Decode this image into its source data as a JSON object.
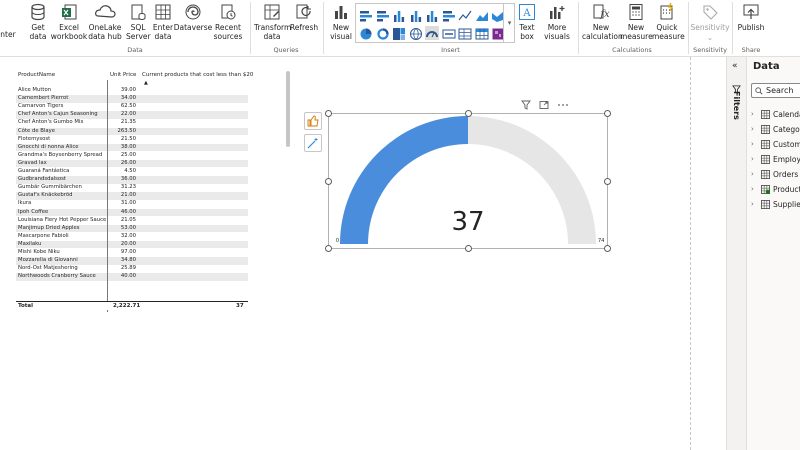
{
  "ribbon": {
    "partial_left": "nter",
    "buttons": {
      "get_data": "Get data",
      "excel": "Excel workbook",
      "onelake": "OneLake data hub",
      "sql": "SQL Server",
      "enter_data": "Enter data",
      "dataverse": "Dataverse",
      "recent": "Recent sources",
      "transform": "Transform data",
      "refresh": "Refresh",
      "new_visual": "New visual",
      "text_box": "Text box",
      "more_visuals": "More visuals",
      "new_calc": "New calculation",
      "new_measure": "New measure",
      "quick_measure": "Quick measure",
      "sensitivity": "Sensitivity",
      "publish": "Publish"
    },
    "groups": {
      "data": "Data",
      "queries": "Queries",
      "insert": "Insert",
      "calculations": "Calculations",
      "sensitivity": "Sensitivity",
      "share": "Share"
    }
  },
  "table": {
    "headers": [
      "ProductName",
      "Unit Price",
      "Current products that cost less than $20"
    ],
    "rows": [
      [
        "Alice Mutton",
        "39.00",
        ""
      ],
      [
        "Camembert Pierrot",
        "34.00",
        ""
      ],
      [
        "Carnarvon Tigers",
        "62.50",
        ""
      ],
      [
        "Chef Anton's Cajun Seasoning",
        "22.00",
        ""
      ],
      [
        "Chef Anton's Gumbo Mix",
        "21.35",
        ""
      ],
      [
        "Côte de Blaye",
        "263.50",
        ""
      ],
      [
        "Flotemysost",
        "21.50",
        ""
      ],
      [
        "Gnocchi di nonna Alice",
        "38.00",
        ""
      ],
      [
        "Grandma's Boysenberry Spread",
        "25.00",
        ""
      ],
      [
        "Gravad lax",
        "26.00",
        ""
      ],
      [
        "Guaraná Fantástica",
        "4.50",
        ""
      ],
      [
        "Gudbrandsdalsost",
        "36.00",
        ""
      ],
      [
        "Gumbär Gummibärchen",
        "31.23",
        ""
      ],
      [
        "Gustaf's Knäckebröd",
        "21.00",
        ""
      ],
      [
        "Ikura",
        "31.00",
        ""
      ],
      [
        "Ipoh Coffee",
        "46.00",
        ""
      ],
      [
        "Louisiana Fiery Hot Pepper Sauce",
        "21.05",
        ""
      ],
      [
        "Manjimup Dried Apples",
        "53.00",
        ""
      ],
      [
        "Mascarpone Fabioli",
        "32.00",
        ""
      ],
      [
        "Maxilaku",
        "20.00",
        ""
      ],
      [
        "Mishi Kobe Niku",
        "97.00",
        ""
      ],
      [
        "Mozzarella di Giovanni",
        "34.80",
        ""
      ],
      [
        "Nord-Ost Matjeshering",
        "25.89",
        ""
      ],
      [
        "Northwoods Cranberry Sauce",
        "40.00",
        ""
      ]
    ],
    "total": [
      "Total",
      "2,222.71",
      "37"
    ]
  },
  "gauge": {
    "value": 37,
    "min": 0,
    "max": 74,
    "min_label": "0",
    "max_label": "74",
    "value_label": "37",
    "fill_color": "#4a8ddc",
    "track_color": "#e6e6e6"
  },
  "panes": {
    "filters_label": "Filters",
    "data_title": "Data",
    "search_placeholder": "Search",
    "tables": [
      "Calendar",
      "Categories",
      "Customers",
      "Employees",
      "Orders",
      "Products",
      "Suppliers"
    ]
  },
  "colors": {
    "accent": "#4a8ddc",
    "ribbon_icon": "#444444",
    "shaded_row": "#eaeaea"
  }
}
